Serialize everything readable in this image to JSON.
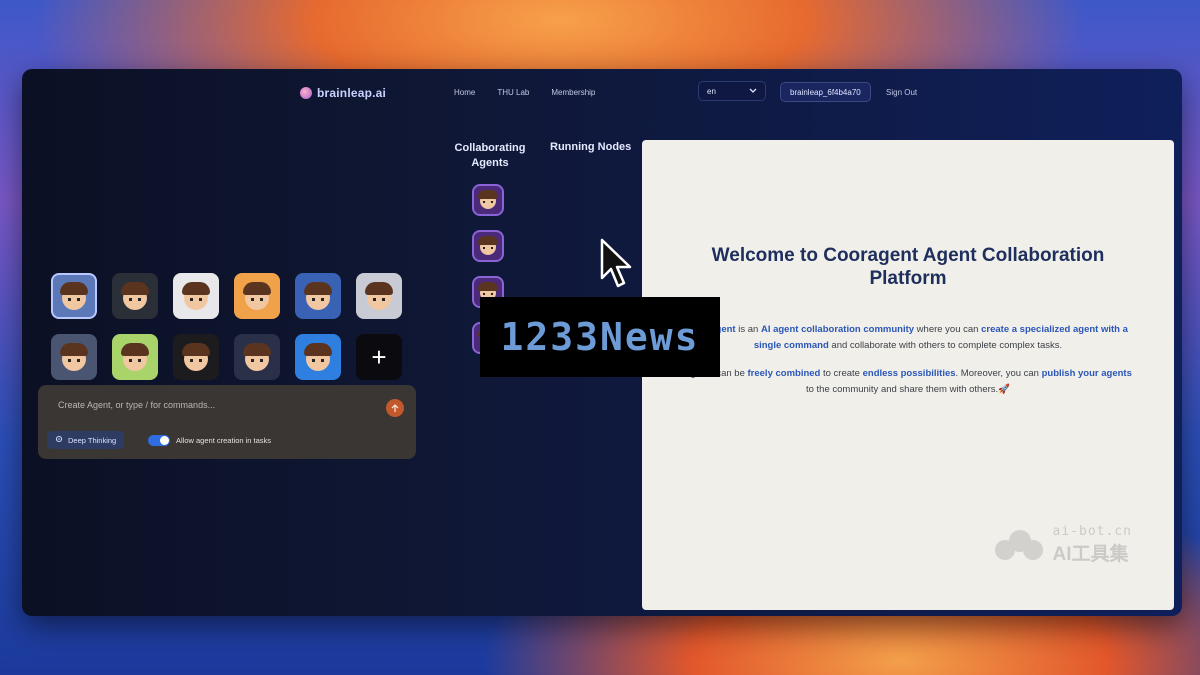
{
  "header": {
    "logo_text": "brainleap.ai",
    "nav": [
      {
        "label": "Home"
      },
      {
        "label": "THU Lab"
      },
      {
        "label": "Membership"
      }
    ],
    "language_selected": "en",
    "user_button": "brainleap_6f4b4a70",
    "sign_out": "Sign Out"
  },
  "agents": {
    "tiles": [
      {
        "bg": "#5b79b8"
      },
      {
        "bg": "#2a2f38"
      },
      {
        "bg": "#e8e8ea"
      },
      {
        "bg": "#f0a24a"
      },
      {
        "bg": "#3a62b4"
      },
      {
        "bg": "#c8cbd3"
      },
      {
        "bg": "#4a5572"
      },
      {
        "bg": "#a9d46a"
      },
      {
        "bg": "#1c1c1e"
      },
      {
        "bg": "#2a3048"
      },
      {
        "bg": "#2e7fe0"
      }
    ],
    "add_label": "+"
  },
  "composer": {
    "placeholder": "Create Agent, or type / for commands...",
    "deep_thinking_label": "Deep Thinking",
    "allow_creation_label": "Allow agent creation in tasks"
  },
  "collaborating": {
    "title": "Collaborating Agents",
    "avatar_count": 4
  },
  "running_nodes": {
    "title": "Running Nodes"
  },
  "welcome": {
    "title": "Welcome to Cooragent Agent Collaboration Platform",
    "p1_a": "Cooragent",
    "p1_b": " is an ",
    "p1_c": "AI agent collaboration community",
    "p1_d": " where you can ",
    "p1_e": "create a specialized agent with a single command",
    "p1_f": " and collaborate with others to complete complex tasks.",
    "p2_a": "Agents can be ",
    "p2_b": "freely combined",
    "p2_c": " to create ",
    "p2_d": "endless possibilities",
    "p2_e": ". Moreover, you can ",
    "p2_f": "publish your agents",
    "p2_g": " to the community and share them with others.",
    "p2_emoji": "🚀"
  },
  "watermark": {
    "domain": "ai-bot.cn",
    "cn_text": "AI工具集"
  },
  "overlay": {
    "text": "1233News"
  }
}
